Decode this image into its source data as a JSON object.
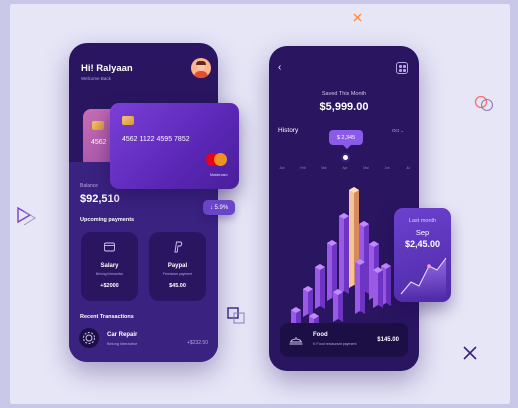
{
  "dashboard": {
    "greeting": "Hi! Ralyaan",
    "subtitle": "Welcome Back",
    "card_back_number": "4562",
    "card_front_number": "4562 1122 4595 7852",
    "card_brand_label": "Mastercard",
    "balance_label": "Balance",
    "balance_value": "$92,510",
    "change_badge": "↓ 5.9%",
    "upcoming_title": "Upcoming payments",
    "payments": [
      {
        "name": "Salary",
        "description": "Belong Interactive",
        "amount": "+$2000",
        "icon": "wallet-icon"
      },
      {
        "name": "Paypal",
        "description": "Freelance payment",
        "amount": "$45.00",
        "icon": "paypal-icon"
      }
    ],
    "recent_title": "Recent Transactions",
    "transaction": {
      "name": "Car Repair",
      "description": "Belong Interactive",
      "amount": "+$232.50",
      "icon": "gear-icon"
    }
  },
  "savings": {
    "saved_label": "Saved This Month",
    "saved_value": "$5,999.00",
    "history_title": "History",
    "history_period": "Oct",
    "tooltip_value": "$ 2,345",
    "months": [
      "Jan",
      "Feb",
      "Mar",
      "Apr",
      "Mal",
      "Jun",
      "Jul"
    ],
    "food": {
      "name": "Food",
      "description": "K Food restaurant payment",
      "amount": "$145.00",
      "icon": "food-icon"
    }
  },
  "last_month": {
    "label": "Last month",
    "month": "Sep",
    "value": "$2,45.00"
  },
  "colors": {
    "background": "#c9c8e9",
    "phone": "#2a1560",
    "panel": "#3a2380",
    "accent": "#8a5ae8",
    "bar_highlight": "#f3c69a"
  }
}
